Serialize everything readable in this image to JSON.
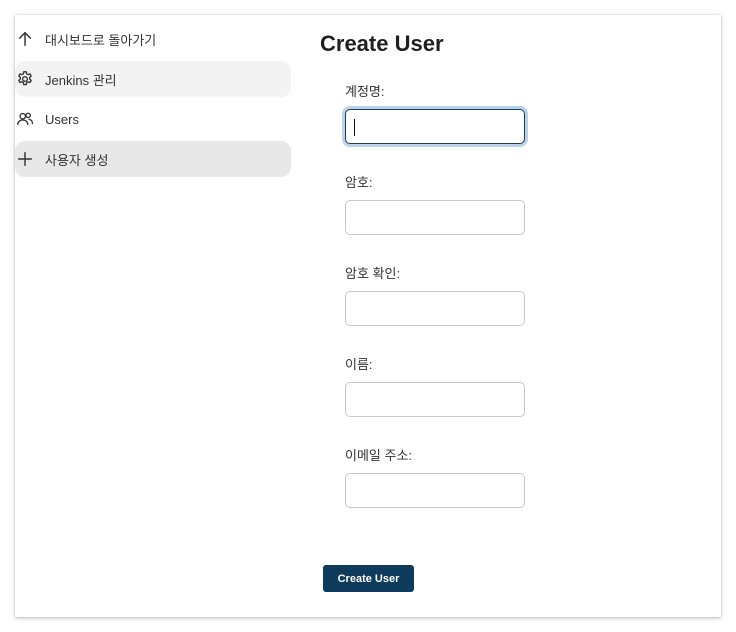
{
  "sidebar": {
    "items": [
      {
        "label": "대시보드로 돌아가기",
        "icon": "arrow-up-icon"
      },
      {
        "label": "Jenkins 관리",
        "icon": "gear-icon"
      },
      {
        "label": "Users",
        "icon": "users-icon"
      },
      {
        "label": "사용자 생성",
        "icon": "plus-icon"
      }
    ]
  },
  "main": {
    "title": "Create User",
    "fields": [
      {
        "label": "계정명:",
        "value": ""
      },
      {
        "label": "암호:",
        "value": ""
      },
      {
        "label": "암호 확인:",
        "value": ""
      },
      {
        "label": "이름:",
        "value": ""
      },
      {
        "label": "이메일 주소:",
        "value": ""
      }
    ],
    "submit_label": "Create User"
  },
  "colors": {
    "primary_button": "#0e3a5c",
    "focus_ring": "#b9d3ea",
    "active_item_bg": "#e8e8e8"
  }
}
